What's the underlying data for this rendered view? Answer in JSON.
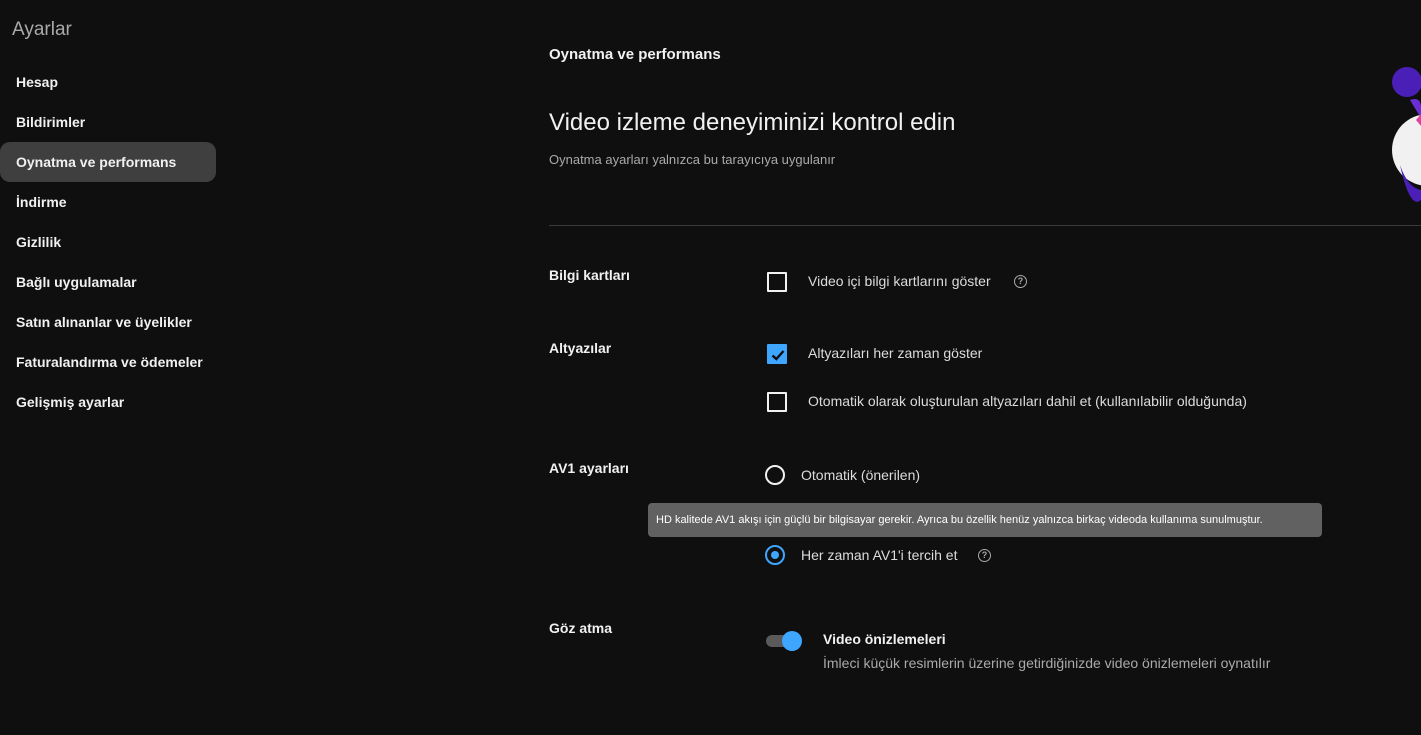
{
  "sidebar": {
    "title": "Ayarlar",
    "items": [
      {
        "label": "Hesap"
      },
      {
        "label": "Bildirimler"
      },
      {
        "label": "Oynatma ve performans"
      },
      {
        "label": "İndirme"
      },
      {
        "label": "Gizlilik"
      },
      {
        "label": "Bağlı uygulamalar"
      },
      {
        "label": "Satın alınanlar ve üyelikler"
      },
      {
        "label": "Faturalandırma ve ödemeler"
      },
      {
        "label": "Gelişmiş ayarlar"
      }
    ],
    "active_item": "Oynatma ve performans"
  },
  "main": {
    "section_label": "Oynatma ve performans",
    "heading": "Video izleme deneyiminizi kontrol edin",
    "subheading": "Oynatma ayarları yalnızca bu tarayıcıya uygulanır",
    "info_cards": {
      "label": "Bilgi kartları",
      "option": {
        "text": "Video içi bilgi kartlarını göster",
        "checked": false
      }
    },
    "captions": {
      "label": "Altyazılar",
      "options": [
        {
          "text": "Altyazıları her zaman göster",
          "checked": true
        },
        {
          "text": "Otomatik olarak oluşturulan altyazıları dahil et (kullanılabilir olduğunda)",
          "checked": false
        }
      ]
    },
    "av1": {
      "label": "AV1 ayarları",
      "options": [
        {
          "text": "Otomatik (önerilen)",
          "selected": false
        },
        {
          "text": "",
          "selected": false
        },
        {
          "text": "Her zaman AV1'i tercih et",
          "selected": true
        }
      ],
      "tooltip": "HD kalitede AV1 akışı için güçlü bir bilgisayar gerekir. Ayrıca bu özellik henüz yalnızca birkaç videoda kullanıma sunulmuştur."
    },
    "peek": {
      "label": "Göz atma",
      "toggle_title": "Video önizlemeleri",
      "toggle_desc": "İmleci küçük resimlerin üzerine getirdiğinizde video önizlemeleri oynatılır",
      "enabled": true
    }
  },
  "help_glyph": "?",
  "colors": {
    "background": "#0f0f0f",
    "accent": "#3ea6ff",
    "active_nav": "#3f3f3f",
    "tooltip": "#616161"
  }
}
